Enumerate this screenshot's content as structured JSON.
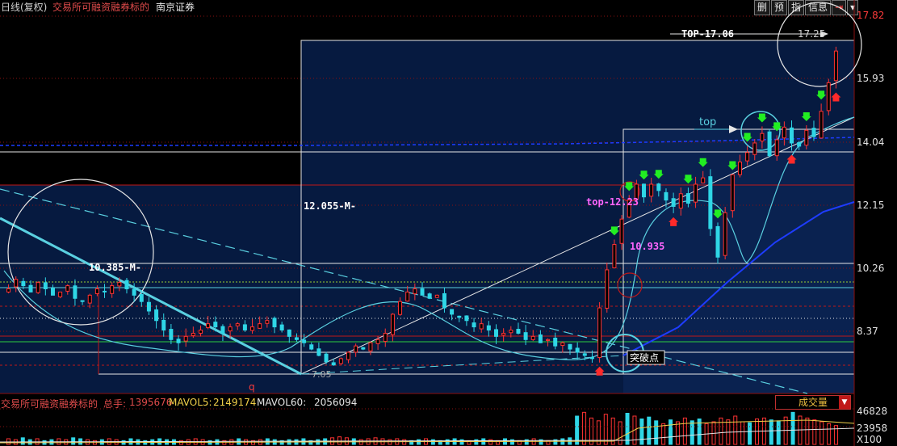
{
  "header": {
    "period": "日线(复权)",
    "category": "交易所可融资融券标的",
    "stock_name": "南京证券",
    "buttons": [
      "删",
      "预",
      "指",
      "信息"
    ]
  },
  "price_axis": {
    "labels": [
      "17.82",
      "15.93",
      "14.04",
      "12.15",
      "10.26",
      "8.37"
    ],
    "values": [
      17.82,
      15.93,
      14.04,
      12.15,
      10.26,
      8.37
    ]
  },
  "annotations": {
    "top_main": "TOP-17.06",
    "top_current": "17.25",
    "top_small": "top",
    "top_1223": "top-12.23",
    "m_12055": "12.055-M-",
    "m_10385": "10.385-M-",
    "v_10935": "10.935",
    "low_705": "7.05",
    "breakout": "突破点",
    "q_label": "q"
  },
  "volume": {
    "name": "交易所可融资融券标的",
    "total_label": "总手:",
    "total_value": "1395676",
    "mavol5_label": "MAVOL5:",
    "mavol5_value": "2149174",
    "mavol60_label": "MAVOL60:",
    "mavol60_value": "2056094",
    "selector": "成交量",
    "axis_labels": [
      "46828",
      "23958",
      "X100"
    ],
    "bars": [
      6,
      5,
      7,
      5,
      6,
      4,
      5,
      6,
      5,
      7,
      6,
      5,
      4,
      5,
      6,
      5,
      4,
      6,
      5,
      4,
      5,
      6,
      5,
      5,
      4,
      5,
      6,
      5,
      4,
      5,
      4,
      5,
      6,
      5,
      4,
      5,
      6,
      5,
      4,
      5,
      5,
      6,
      4,
      5,
      6,
      7,
      8,
      7,
      6,
      5,
      6,
      7,
      6,
      5,
      6,
      5,
      4,
      5,
      6,
      5,
      4,
      5,
      6,
      5,
      4,
      5,
      6,
      5,
      4,
      6,
      5,
      4,
      5,
      6,
      5,
      4,
      5,
      6,
      7,
      30,
      34,
      28,
      25,
      32,
      28,
      24,
      33,
      30,
      27,
      29,
      25,
      22,
      26,
      24,
      28,
      25,
      27,
      22,
      24,
      28,
      26,
      30,
      24,
      23,
      27,
      28,
      26,
      25,
      29,
      34,
      30,
      28,
      26,
      24,
      22,
      20
    ]
  },
  "colors": {
    "up": "#ff3333",
    "down": "#2fd6e6",
    "grid": "#8a1010",
    "panel": "#061a40",
    "arrow_buy": "#ff2a2a",
    "arrow_sell": "#22ee22",
    "ma": "#5ad0e0"
  },
  "chart_data": {
    "type": "candlestick",
    "title": "",
    "ylim": [
      6.3,
      18.2
    ],
    "close": [
      9.6,
      9.9,
      9.7,
      9.5,
      9.8,
      9.6,
      9.4,
      9.5,
      9.7,
      9.3,
      9.2,
      9.4,
      9.6,
      9.5,
      9.7,
      9.8,
      9.6,
      9.4,
      9.2,
      8.9,
      8.6,
      8.3,
      8.0,
      7.9,
      8.1,
      8.2,
      8.3,
      8.5,
      8.4,
      8.2,
      8.4,
      8.5,
      8.3,
      8.4,
      8.5,
      8.6,
      8.4,
      8.3,
      8.1,
      8.0,
      7.9,
      7.7,
      7.5,
      7.3,
      7.2,
      7.4,
      7.6,
      7.8,
      7.7,
      7.9,
      8.0,
      8.2,
      8.8,
      9.2,
      9.5,
      9.6,
      9.4,
      9.3,
      9.4,
      9.0,
      8.8,
      8.7,
      8.6,
      8.4,
      8.5,
      8.3,
      8.1,
      8.2,
      8.3,
      8.2,
      8.0,
      8.1,
      7.9,
      8.0,
      7.8,
      7.9,
      7.7,
      7.6,
      7.5,
      7.4,
      9.0,
      10.2,
      11.0,
      11.8,
      12.4,
      12.9,
      12.5,
      12.9,
      12.7,
      12.4,
      12.2,
      12.6,
      12.3,
      12.9,
      13.1,
      11.5,
      10.6,
      12.0,
      13.2,
      13.6,
      13.9,
      14.2,
      14.5,
      13.8,
      14.3,
      14.7,
      14.2,
      14.1,
      14.6,
      14.4,
      15.2,
      16.1,
      17.1
    ]
  }
}
